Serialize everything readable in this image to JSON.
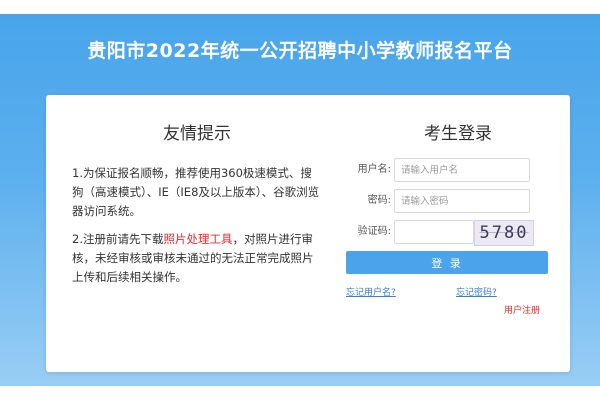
{
  "header": {
    "title": "贵阳市2022年统一公开招聘中小学教师报名平台"
  },
  "tips": {
    "title": "友情提示",
    "p1": "1.为保证报名顺畅，推荐使用360极速模式、搜狗（高速模式）、IE（IE8及以上版本）、谷歌浏览器访问系统。",
    "p2_before": "2.注册前请先下载",
    "p2_link": "照片处理工具",
    "p2_after": "，对照片进行审核，未经审核或审核未通过的无法正常完成照片上传和后续相关操作。"
  },
  "login": {
    "title": "考生登录",
    "username_label": "用户名:",
    "username_placeholder": "请输入用户名",
    "password_label": "密码:",
    "password_placeholder": "请输入密码",
    "captcha_label": "验证码:",
    "captcha_value": "",
    "captcha_code": "5780",
    "submit_label": "登 录",
    "forgot_username": "忘记用户名?",
    "forgot_password": "忘记密码?",
    "register": "用户注册"
  },
  "colors": {
    "accent": "#4aa3eb",
    "highlight": "#e02b2b",
    "link": "#3a7fd0"
  }
}
